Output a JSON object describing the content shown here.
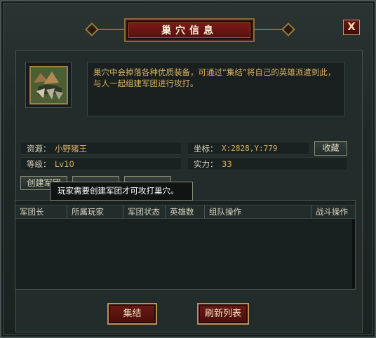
{
  "window": {
    "title": "巢穴信息",
    "close_label": "X"
  },
  "description": "巢穴中会掉落各种优质装备，可通过“集结”将自己的英雄派遣到此，与人一起组建军团进行攻打。",
  "info": {
    "resource_label": "资源：",
    "resource_value": "小野猪王",
    "level_label": "等级：",
    "level_value": "Lv10",
    "coord_label": "坐标：",
    "coord_value": "X:2828,Y:779",
    "power_label": "实力：",
    "power_value": "33",
    "favorite_label": "收藏"
  },
  "actions": {
    "create_legion": "创建军团",
    "button2": "",
    "button3": ""
  },
  "tooltip": "玩家需要创建军团才可攻打巢穴。",
  "table": {
    "columns": [
      "军团长",
      "所属玩家",
      "军团状态",
      "英雄数",
      "组队操作",
      "战斗操作"
    ],
    "rows": []
  },
  "footer": {
    "rally_label": "集结",
    "refresh_label": "刷新列表"
  },
  "colors": {
    "accent_gold": "#d8b060",
    "title_red": "#7a1a18",
    "frame_dark": "#1f2826"
  }
}
